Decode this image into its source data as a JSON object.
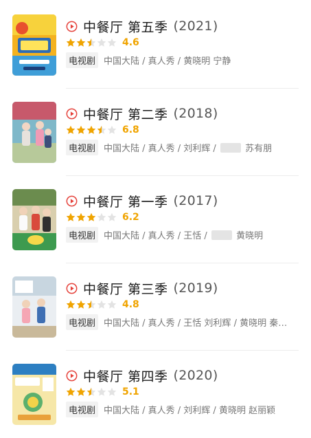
{
  "accent_color": "#f0a400",
  "play_color": "#e5413a",
  "items": [
    {
      "title": "中餐厅 第五季",
      "year": "(2021)",
      "stars_filled": 2.5,
      "score": "4.6",
      "type": "电视剧",
      "meta_a": "中国大陆 / 真人秀 / 黄晓明 宁静",
      "meta_b": ""
    },
    {
      "title": "中餐厅 第二季",
      "year": "(2018)",
      "stars_filled": 3.5,
      "score": "6.8",
      "type": "电视剧",
      "meta_a": "中国大陆 / 真人秀 / 刘利辉 /",
      "meta_b": "苏有朋"
    },
    {
      "title": "中餐厅 第一季",
      "year": "(2017)",
      "stars_filled": 3,
      "score": "6.2",
      "type": "电视剧",
      "meta_a": "中国大陆 / 真人秀 / 王恬 /",
      "meta_b": "黄晓明"
    },
    {
      "title": "中餐厅 第三季",
      "year": "(2019)",
      "stars_filled": 2.5,
      "score": "4.8",
      "type": "电视剧",
      "meta_a": "中国大陆 / 真人秀 / 王恬 刘利辉 / 黄晓明 秦…",
      "meta_b": ""
    },
    {
      "title": "中餐厅 第四季",
      "year": "(2020)",
      "stars_filled": 2.5,
      "score": "5.1",
      "type": "电视剧",
      "meta_a": "中国大陆 / 真人秀 / 刘利辉 / 黄晓明 赵丽颖",
      "meta_b": ""
    }
  ]
}
